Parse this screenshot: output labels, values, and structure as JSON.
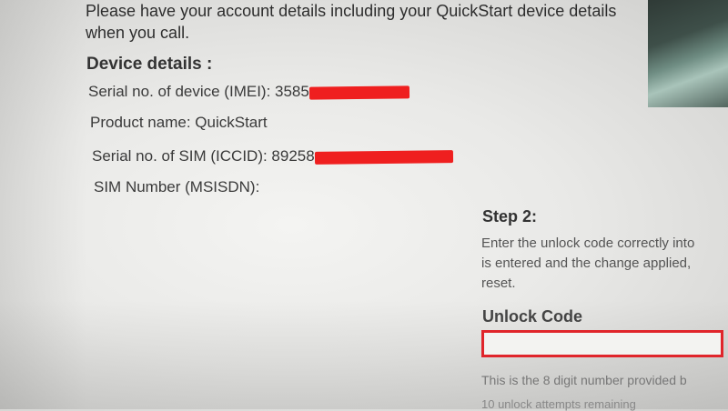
{
  "notice": {
    "line1": "Please have your account details including your QuickStart device details",
    "line2": "when you call."
  },
  "device_details": {
    "heading": "Device details :",
    "imei_label": "Serial no. of device (IMEI): 3585",
    "product_name": "Product name: QuickStart",
    "iccid_label": "Serial no. of SIM (ICCID): 89258",
    "msisdn_label": "SIM Number (MSISDN):"
  },
  "step2": {
    "title": "Step 2:",
    "line1": "Enter the unlock code correctly into",
    "line2": "is entered and the change applied,",
    "line3": "reset."
  },
  "unlock": {
    "label": "Unlock Code",
    "value": "",
    "help": "This is the 8 digit number provided b",
    "attempts": "10 unlock attempts remaining"
  },
  "colors": {
    "redaction": "#ef1f1f",
    "input_border": "#e0252b"
  }
}
